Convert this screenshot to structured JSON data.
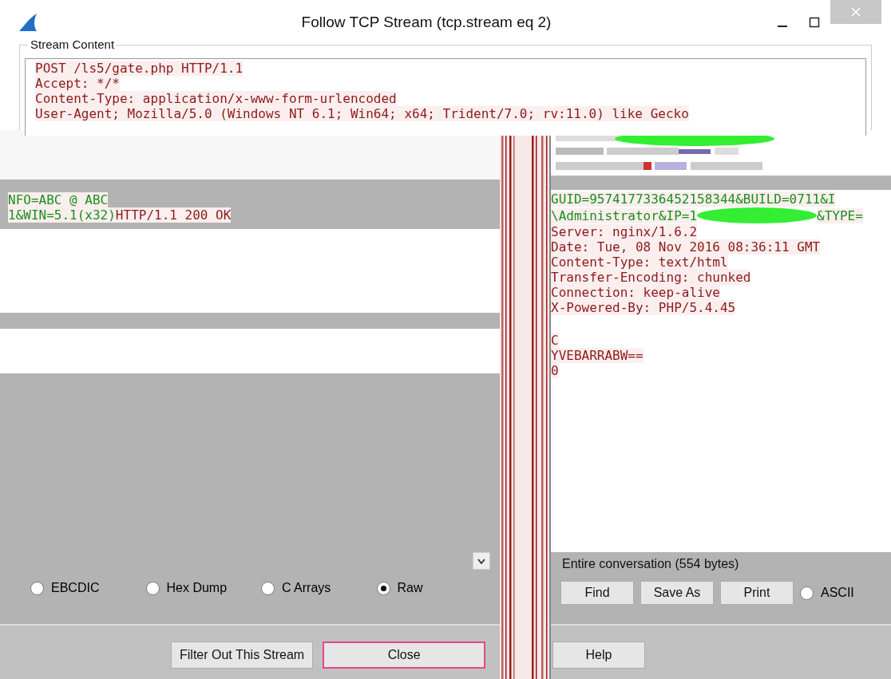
{
  "window": {
    "title": "Follow TCP Stream (tcp.stream eq 2)"
  },
  "stream_content": {
    "label": "Stream Content",
    "lines": [
      {
        "text": "POST /ls5/gate.php HTTP/1.1",
        "color": "#8b1a1a"
      },
      {
        "text": "Accept: */*",
        "color": "#8b1a1a"
      },
      {
        "text": "Content-Type: application/x-www-form-urlencoded",
        "color": "#8b1a1a"
      },
      {
        "text": "User-Agent; Mozilla/5.0 (Windows NT 6.1; Win64; x64; Trident/7.0; rv:11.0) like Gecko",
        "color": "#8b1a1a"
      }
    ]
  },
  "left_pane": {
    "lines": [
      {
        "text": "NFO=ABC @ ABC",
        "color": "#1a8f1a"
      },
      {
        "text": "1&WIN=5.1(x32)",
        "color": "#1a8f1a",
        "continuation": {
          "text": "HTTP/1.1 200 OK",
          "color": "#8b1a1a"
        }
      }
    ],
    "show_as": [
      {
        "label": "EBCDIC",
        "selected": false
      },
      {
        "label": "Hex Dump",
        "selected": false
      },
      {
        "label": "C Arrays",
        "selected": false
      },
      {
        "label": "Raw",
        "selected": true
      }
    ],
    "buttons": [
      {
        "label": "Filter Out This Stream",
        "default": false
      },
      {
        "label": "Close",
        "default": true
      }
    ]
  },
  "right_pane": {
    "lines": [
      {
        "text": "GUID=9574177336452158344&BUILD=0711&I",
        "color": "#1a8f1a",
        "redaction": false
      },
      {
        "text": "\\Administrator&IP=1",
        "color": "#1a8f1a",
        "redaction": true,
        "text_after": "&TYPE="
      },
      {
        "text": "Server: nginx/1.6.2",
        "color": "#8b1a1a",
        "redaction": false
      },
      {
        "text": "Date: Tue, 08 Nov 2016 08:36:11 GMT",
        "color": "#8b1a1a",
        "redaction": false
      },
      {
        "text": "Content-Type: text/html",
        "color": "#8b1a1a",
        "redaction": false
      },
      {
        "text": "Transfer-Encoding: chunked",
        "color": "#8b1a1a",
        "redaction": false
      },
      {
        "text": "Connection: keep-alive",
        "color": "#8b1a1a",
        "redaction": false
      },
      {
        "text": "X-Powered-By: PHP/5.4.45",
        "color": "#8b1a1a",
        "redaction": false
      }
    ],
    "body_lines": [
      {
        "text": "C",
        "color": "#8b1a1a"
      },
      {
        "text": "YVEBARRABW==",
        "color": "#8b1a1a"
      },
      {
        "text": "0",
        "color": "#8b1a1a"
      }
    ],
    "summary": "Entire conversation (554 bytes)",
    "buttons": [
      {
        "label": "Find"
      },
      {
        "label": "Save As"
      },
      {
        "label": "Print"
      }
    ],
    "encoding": {
      "label": "ASCII",
      "selected": false
    },
    "help_button": "Help"
  }
}
